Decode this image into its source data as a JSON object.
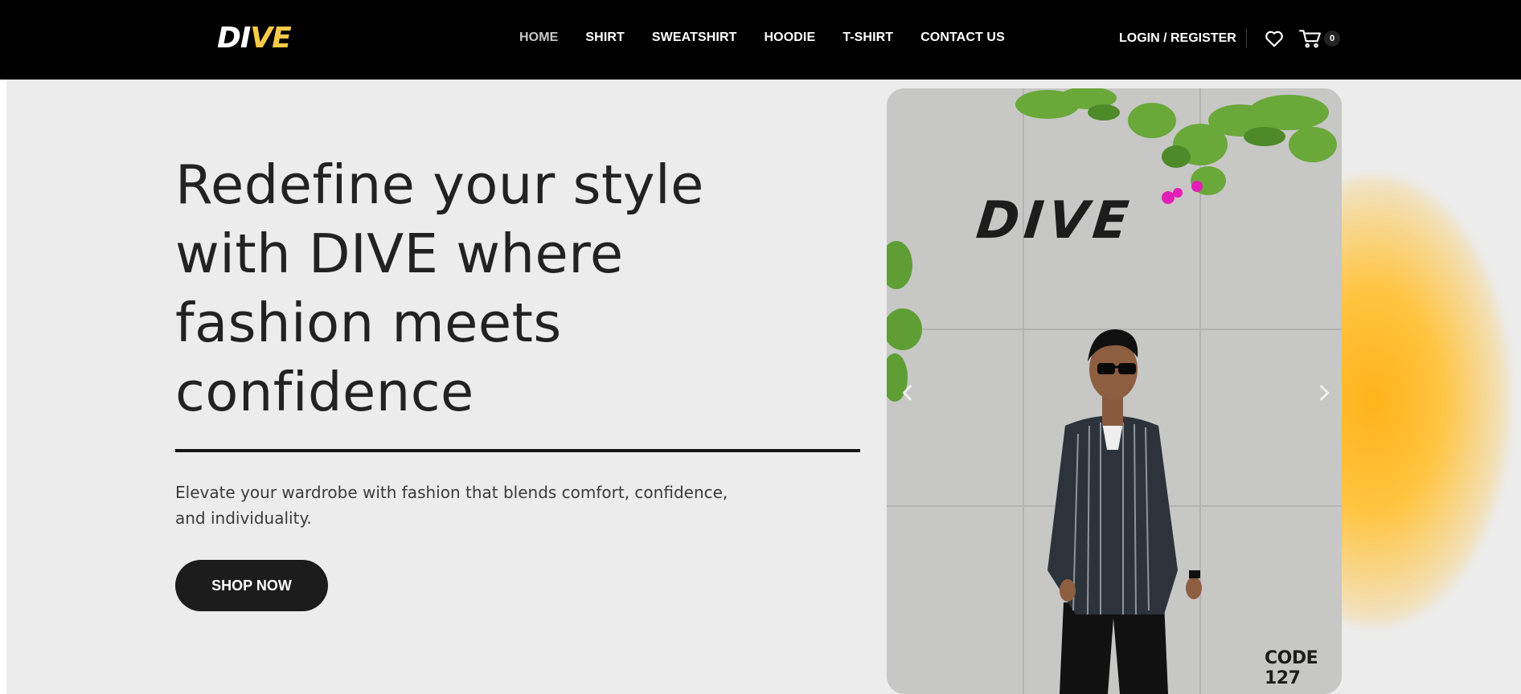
{
  "header": {
    "logo_part1": "DI",
    "logo_part2": "VE",
    "nav": [
      {
        "label": "HOME",
        "active": true
      },
      {
        "label": "SHIRT",
        "active": false
      },
      {
        "label": "SWEATSHIRT",
        "active": false
      },
      {
        "label": "HOODIE",
        "active": false
      },
      {
        "label": "T-SHIRT",
        "active": false
      },
      {
        "label": "CONTACT US",
        "active": false
      }
    ],
    "account_label": "LOGIN / REGISTER",
    "icons": [
      "heart-icon",
      "cart-icon"
    ],
    "cart_count": "0"
  },
  "hero": {
    "headline": "Redefine your style with DIVE where fashion meets confidence",
    "subcopy": "Elevate your wardrobe with fashion that blends comfort, confidence, and individuality.",
    "cta_label": "SHOP NOW"
  },
  "slider": {
    "wall_logo": "DIVE",
    "wall_code": "CODE 127",
    "prev_icon": "chevron-left-icon",
    "next_icon": "chevron-right-icon"
  },
  "colors": {
    "header_bg": "#000000",
    "hero_bg": "#ececec",
    "logo_accent": "#f7c948",
    "glow": "#ffb21a",
    "button_bg": "#1c1c1c"
  }
}
